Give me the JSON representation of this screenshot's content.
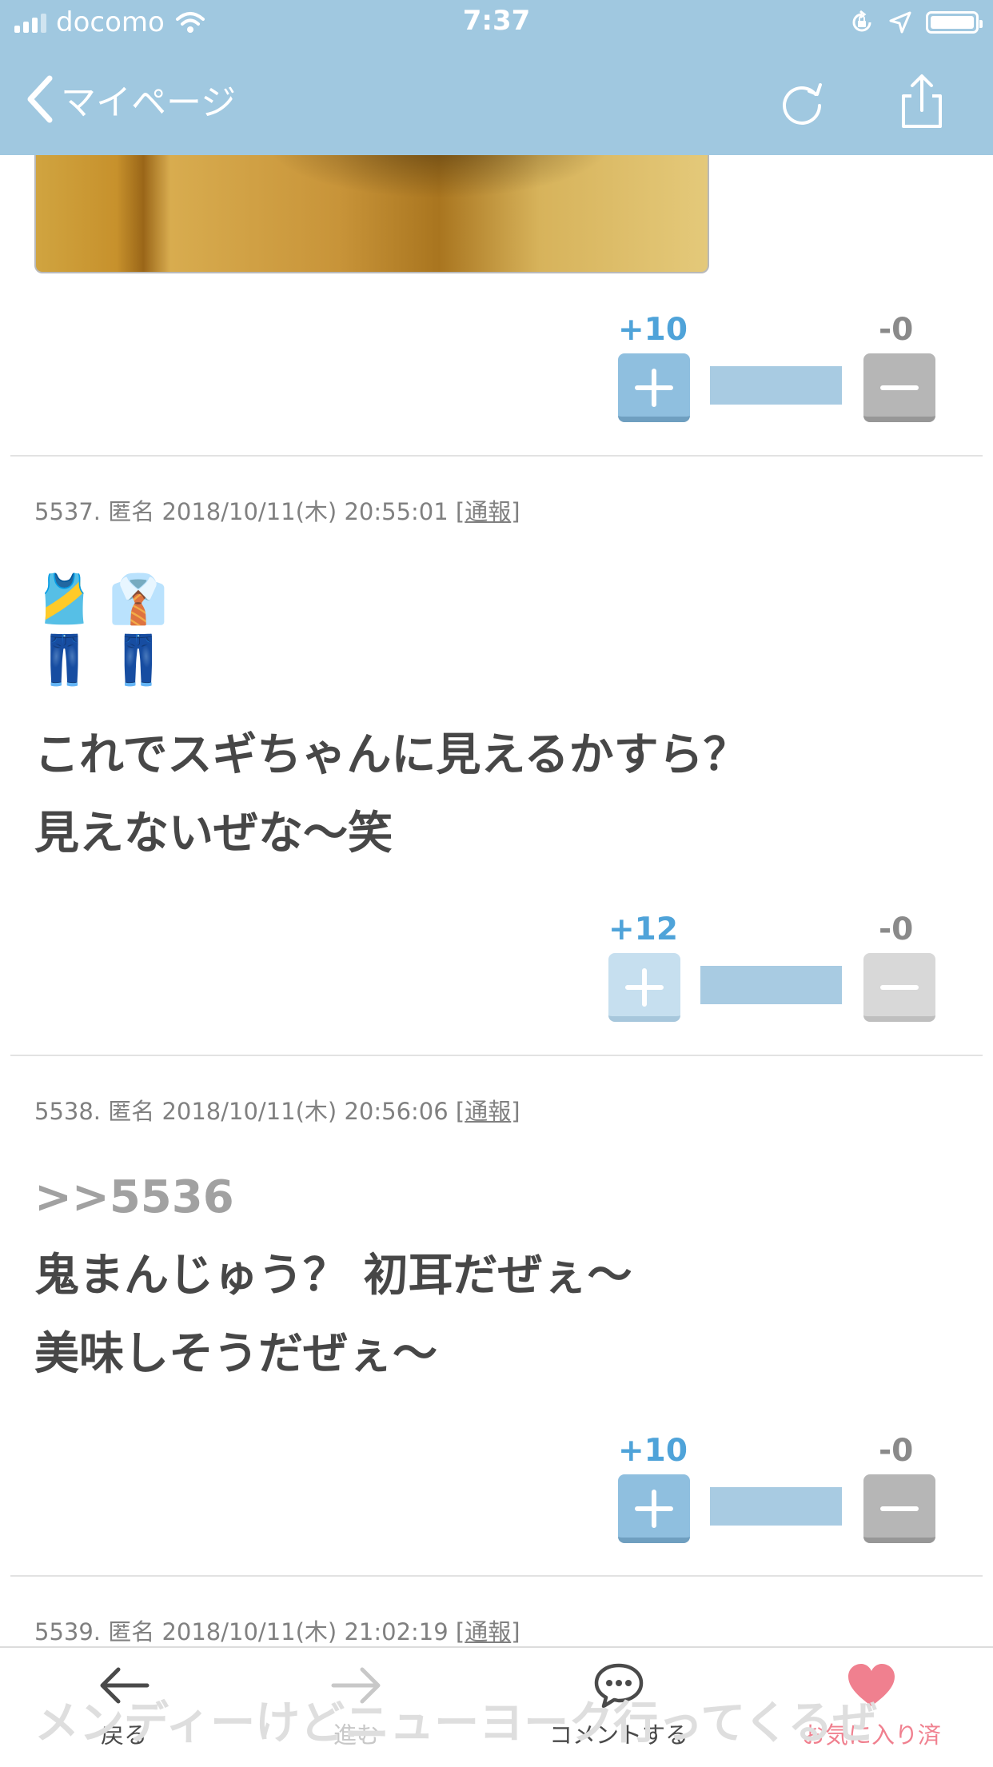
{
  "status_bar": {
    "carrier": "docomo",
    "time": "7:37"
  },
  "nav": {
    "back_label": "マイページ",
    "icons": [
      "chevron-left-icon",
      "refresh-icon",
      "share-icon"
    ]
  },
  "posts": [
    {
      "plus": "+10",
      "minus": "-0",
      "plus_active": true
    },
    {
      "meta_prefix": "5537. 匿名 2018/10/11(木) 20:55:01 [",
      "report": "通報",
      "meta_suffix": "]",
      "emoji_row1": "🎽👔",
      "emoji_row2": "👖👖",
      "line1": "これでスギちゃんに見えるかすら？",
      "line2": "見えないぜな〜笑",
      "plus": "+12",
      "minus": "-0",
      "plus_active": false
    },
    {
      "meta_prefix": "5538. 匿名 2018/10/11(木) 20:56:06 [",
      "report": "通報",
      "meta_suffix": "]",
      "anchor": ">>5536",
      "line1": "鬼まんじゅう？ 初耳だぜぇ〜",
      "line2": "美味しそうだぜぇ〜",
      "plus": "+10",
      "minus": "-0",
      "plus_active": true
    },
    {
      "meta_prefix": "5539. 匿名 2018/10/11(木) 21:02:19 [",
      "report": "通報",
      "meta_suffix": "]",
      "line1": "メンディーけどニューヨーク行ってくるぜ"
    }
  ],
  "toolbar": {
    "back": "戻る",
    "forward": "進む",
    "comment": "コメントする",
    "favorite": "お気に入り済"
  },
  "colors": {
    "bar": "#a0c8e0",
    "plus": "#4fa3d9",
    "favorite": "#f0808f"
  }
}
